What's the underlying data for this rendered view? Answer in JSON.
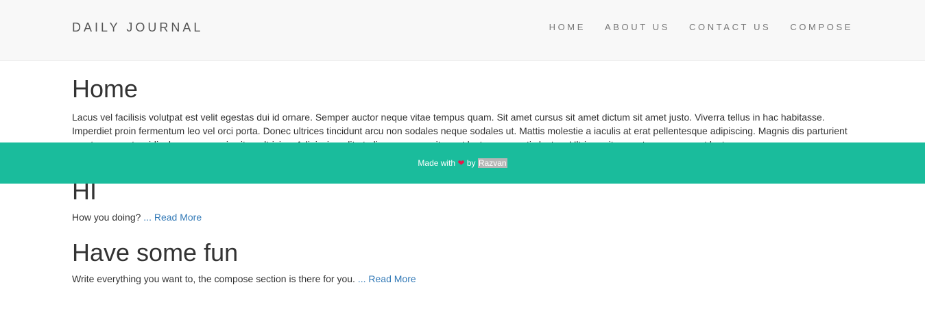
{
  "nav": {
    "brand": "DAILY JOURNAL",
    "links": [
      "HOME",
      "ABOUT US",
      "CONTACT US",
      "COMPOSE"
    ]
  },
  "main": {
    "title": "Home",
    "intro": "Lacus vel facilisis volutpat est velit egestas dui id ornare. Semper auctor neque vitae tempus quam. Sit amet cursus sit amet dictum sit amet justo. Viverra tellus in hac habitasse. Imperdiet proin fermentum leo vel orci porta. Donec ultrices tincidunt arcu non sodales neque sodales ut. Mattis molestie a iaculis at erat pellentesque adipiscing. Magnis dis parturient montes nascetur ridiculus mus mauris vitae ultricies. Adipiscing elit ut aliquam purus sit amet luctus venenatis lectus. Ultrices vitae auctor eu augue ut lectus arcu."
  },
  "posts": [
    {
      "title": "HI",
      "excerpt": "How you doing?",
      "ellipsis": " ... ",
      "read_more": "Read More"
    },
    {
      "title": "Have some fun",
      "excerpt": "Write everything you want to, the compose section is there for you.",
      "ellipsis": " ... ",
      "read_more": "Read More"
    }
  ],
  "footer": {
    "made_with": "Made with",
    "heart": "❤",
    "by": "by",
    "author": "Razvan"
  },
  "colors": {
    "footer_bg": "#1abc9c",
    "link": "#337ab7",
    "heart": "#e8174b"
  }
}
